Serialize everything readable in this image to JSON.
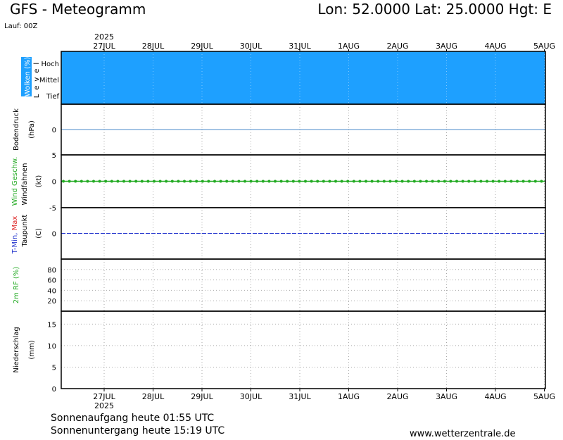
{
  "header": {
    "title": "GFS - Meteogramm",
    "coords": "Lon: 52.0000  Lat: 25.0000  Hgt: E",
    "run": "Lauf: 00Z"
  },
  "footer": {
    "sunrise": "Sonnenaufgang heute 01:55 UTC",
    "sunset": "Sonnenuntergang heute 15:19 UTC",
    "website": "www.wetterzentrale.de"
  },
  "chart_data": {
    "type": "line",
    "year_label": "2025",
    "dates": [
      "27JUL",
      "28JUL",
      "29JUL",
      "30JUL",
      "31JUL",
      "1AUG",
      "2AUG",
      "3AUG",
      "4AUG",
      "5AUG"
    ],
    "colors": {
      "cloud": "#1ea0ff",
      "wind": "#22aa22",
      "tmin": "#2233cc",
      "tmax": "#dd2222",
      "humidity": "#22aa22",
      "pressure_line": "#4a88c8"
    },
    "panels": {
      "clouds": {
        "label": "Wolken (%)",
        "level_label": "Level",
        "levels": [
          "Hoch",
          "Mittel",
          "Tief"
        ],
        "coverage_percent": 100
      },
      "pressure": {
        "label1": "Bodendruck",
        "label2": "(hPa)",
        "ticks": [
          "0"
        ],
        "value": 0
      },
      "wind": {
        "label_colored": "Wind Geschw.",
        "label2": "Windfahnen",
        "label3": "(kt)",
        "ticks": [
          "5",
          "0",
          "-5"
        ],
        "ylim": [
          -5,
          5
        ],
        "value": 0
      },
      "temp": {
        "label_min": "T-Min",
        "label_sep": ", ",
        "label_max": "Max",
        "label2": "Taupunkt",
        "label3": "(C)",
        "ticks": [
          "0"
        ],
        "value": 0
      },
      "humidity": {
        "label": "2m RF (%)",
        "ticks": [
          "80",
          "60",
          "40",
          "20"
        ]
      },
      "precip": {
        "label1": "Niederschlag",
        "label2": "(mm)",
        "ticks": [
          "15",
          "10",
          "5",
          "0"
        ]
      }
    }
  }
}
